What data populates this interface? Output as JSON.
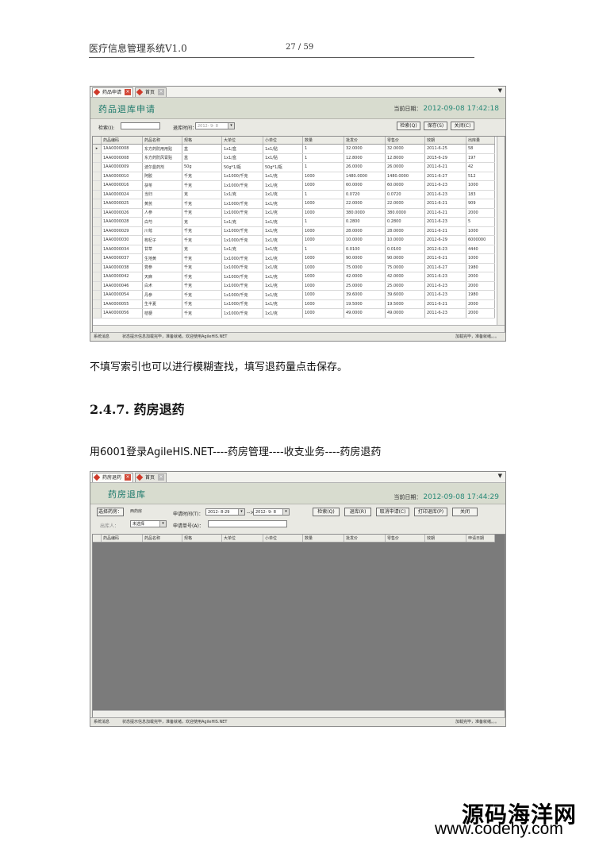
{
  "header": {
    "title": "医疗信息管理系统V1.0",
    "page": "27 / 59"
  },
  "window1": {
    "tabs": [
      "药品申请",
      "首页"
    ],
    "title": "药品退库申请",
    "current_date_label": "当前日期：",
    "current_date_value": "2012-09-08 17:42:18",
    "filter": {
      "index_label": "检索(I):",
      "date_label": "退库时间：",
      "date_value": "2012- 9- 8"
    },
    "buttons": {
      "search": "检索(Q)",
      "save": "保存(S)",
      "close": "关闭(C)"
    },
    "columns": [
      "药品编码",
      "药品名称",
      "规格",
      "大单位",
      "小单位",
      "数量",
      "批发价",
      "零售价",
      "效期",
      "出库量"
    ],
    "rows": [
      [
        "1AA0000008",
        "东方药防用用贴",
        "盒",
        "1x1/盒",
        "1x1/贴",
        "1",
        "32.0000",
        "32.0000",
        "2011-6-25",
        "58"
      ],
      [
        "1AA0000008",
        "东方药防风膏贴",
        "盒",
        "1x1/盒",
        "1x1/贴",
        "1",
        "12.8000",
        "12.8000",
        "2015-6-29",
        "197"
      ],
      [
        "1AA0000009",
        "波尔曼药剂",
        "50g",
        "50g*1/瓶",
        "50g*1/瓶",
        "1",
        "26.0000",
        "26.0000",
        "2011-6-21",
        "42"
      ],
      [
        "1AA0000010",
        "阿胶",
        "千克",
        "1x1000/千克",
        "1x1/克",
        "1000",
        "1480.0000",
        "1480.0000",
        "2011-6-27",
        "512"
      ],
      [
        "1AA0000016",
        "茯苓",
        "千克",
        "1x1000/千克",
        "1x1/克",
        "1000",
        "60.0000",
        "60.0000",
        "2011-6-23",
        "1000"
      ],
      [
        "1AA0000024",
        "当归",
        "克",
        "1x1/克",
        "1x1/克",
        "1",
        "0.0720",
        "0.0720",
        "2011-6-23",
        "183"
      ],
      [
        "1AA0000025",
        "黄芪",
        "千克",
        "1x1000/千克",
        "1x1/克",
        "1000",
        "22.0000",
        "22.0000",
        "2011-6-21",
        "909"
      ],
      [
        "1AA0000026",
        "人参",
        "千克",
        "1x1000/千克",
        "1x1/克",
        "1000",
        "380.0000",
        "380.0000",
        "2011-6-21",
        "2000"
      ],
      [
        "1AA0000028",
        "白芍",
        "克",
        "1x1/克",
        "1x1/克",
        "1",
        "0.2800",
        "0.2800",
        "2011-6-23",
        "5"
      ],
      [
        "1AA0000029",
        "川芎",
        "千克",
        "1x1000/千克",
        "1x1/克",
        "1000",
        "28.0000",
        "28.0000",
        "2011-6-21",
        "1000"
      ],
      [
        "1AA0000030",
        "枸杞子",
        "千克",
        "1x1000/千克",
        "1x1/克",
        "1000",
        "10.0000",
        "10.0000",
        "2012-6-29",
        "6000000"
      ],
      [
        "1AA0000034",
        "甘草",
        "克",
        "1x1/克",
        "1x1/克",
        "1",
        "0.0100",
        "0.0100",
        "2012-6-23",
        "4440"
      ],
      [
        "1AA0000037",
        "生地黄",
        "千克",
        "1x1000/千克",
        "1x1/克",
        "1000",
        "90.0000",
        "90.0000",
        "2011-6-21",
        "1000"
      ],
      [
        "1AA0000038",
        "党参",
        "千克",
        "1x1000/千克",
        "1x1/克",
        "1000",
        "75.0000",
        "75.0000",
        "2011-6-27",
        "1980"
      ],
      [
        "1AA0000042",
        "天麻",
        "千克",
        "1x1000/千克",
        "1x1/克",
        "1000",
        "42.0000",
        "42.0000",
        "2011-6-23",
        "2000"
      ],
      [
        "1AA0000046",
        "白术",
        "千克",
        "1x1000/千克",
        "1x1/克",
        "1000",
        "25.0000",
        "25.0000",
        "2011-6-23",
        "2000"
      ],
      [
        "1AA0000054",
        "丹参",
        "千克",
        "1x1000/千克",
        "1x1/克",
        "1000",
        "39.6000",
        "39.6000",
        "2011-6-23",
        "1980"
      ],
      [
        "1AA0000055",
        "生半夏",
        "千克",
        "1x1000/千克",
        "1x1/克",
        "1000",
        "19.5000",
        "19.5000",
        "2011-6-21",
        "2000"
      ],
      [
        "1AA0000056",
        "桔梗",
        "千克",
        "1x1000/千克",
        "1x1/克",
        "1000",
        "49.0000",
        "49.0000",
        "2011-6-23",
        "2000"
      ]
    ],
    "status_left": "系统消息",
    "status_mid": "状态提示信息加载完毕，准备就绪，欢迎使用AgileHIS.NET",
    "status_right": "加载完毕，准备就绪。。。"
  },
  "para1": "不填写索引也可以进行模糊查找，填写退药量点击保存。",
  "section_heading": "2.4.7. 药房退药",
  "para2": "用6001登录AgileHIS.NET----药房管理----收支业务----药房退药",
  "window2": {
    "tabs": [
      "药房退药",
      "首页"
    ],
    "title": "药房退库",
    "current_date_label": "当前日期：",
    "current_date_value": "2012-09-08 17:44:29",
    "filter": {
      "choose_label": "选择药房：",
      "choose_value": "西药房",
      "date_label": "申请时间(T)：",
      "date_from": "2012- 8-29",
      "date_to": "2012- 9- 8",
      "dept_label": "出库人：",
      "dept_value": "未选择",
      "doc_label": "申请单号(A)："
    },
    "buttons": {
      "search": "检索(Q)",
      "refund": "退库(R)",
      "cancel": "取消申请(C)",
      "print": "打印退库(P)",
      "close": "关闭"
    },
    "columns": [
      "药品编码",
      "药品名称",
      "规格",
      "大单位",
      "小单位",
      "数量",
      "批发价",
      "零售价",
      "效期",
      "申请日期"
    ],
    "status_left": "系统消息",
    "status_mid": "状态提示信息加载完毕，准备就绪，欢迎使用AgileHIS.NET",
    "status_right": "加载完毕，准备就绪。。。"
  },
  "watermark": {
    "line1": "源码海洋网",
    "line2": "www.codehy.com"
  }
}
